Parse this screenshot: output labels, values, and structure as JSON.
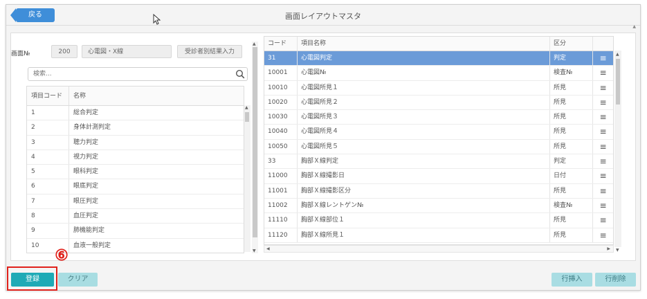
{
  "header": {
    "back_label": "戻る",
    "title": "画面レイアウトマスタ"
  },
  "form": {
    "screen_no_label": "画面№",
    "screen_no_value": "200",
    "screen_name_value": "心電図・X線",
    "result_input_button": "受診者別結果入力"
  },
  "search": {
    "placeholder": "検索..."
  },
  "left_table": {
    "columns": [
      "項目コード",
      "名称"
    ],
    "rows": [
      {
        "code": "1",
        "name": "総合判定"
      },
      {
        "code": "2",
        "name": "身体計測判定"
      },
      {
        "code": "3",
        "name": "聴力判定"
      },
      {
        "code": "4",
        "name": "視力判定"
      },
      {
        "code": "5",
        "name": "眼科判定"
      },
      {
        "code": "6",
        "name": "眼底判定"
      },
      {
        "code": "7",
        "name": "眼圧判定"
      },
      {
        "code": "8",
        "name": "血圧判定"
      },
      {
        "code": "9",
        "name": "肺機能判定"
      },
      {
        "code": "10",
        "name": "血液一般判定"
      }
    ]
  },
  "right_table": {
    "columns": [
      "コード",
      "項目名称",
      "区分"
    ],
    "rows": [
      {
        "code": "31",
        "name": "心電図判定",
        "kubun": "判定",
        "selected": true
      },
      {
        "code": "10001",
        "name": "心電図№",
        "kubun": "検査№"
      },
      {
        "code": "10010",
        "name": "心電図所見１",
        "kubun": "所見"
      },
      {
        "code": "10020",
        "name": "心電図所見２",
        "kubun": "所見"
      },
      {
        "code": "10030",
        "name": "心電図所見３",
        "kubun": "所見"
      },
      {
        "code": "10040",
        "name": "心電図所見４",
        "kubun": "所見"
      },
      {
        "code": "10050",
        "name": "心電図所見５",
        "kubun": "所見"
      },
      {
        "code": "33",
        "name": "胸部Ｘ線判定",
        "kubun": "判定"
      },
      {
        "code": "11000",
        "name": "胸部Ｘ線撮影日",
        "kubun": "日付"
      },
      {
        "code": "11001",
        "name": "胸部Ｘ線撮影区分",
        "kubun": "所見"
      },
      {
        "code": "11002",
        "name": "胸部Ｘ線レントゲン№",
        "kubun": "検査№"
      },
      {
        "code": "11110",
        "name": "胸部Ｘ線部位１",
        "kubun": "所見"
      },
      {
        "code": "11120",
        "name": "胸部Ｘ線所見１",
        "kubun": "所見"
      }
    ],
    "menu_glyph": "≡",
    "selected_color": "#6b9bd8"
  },
  "footer": {
    "register_label": "登録",
    "clear_label": "クリア",
    "insert_row_label": "行挿入",
    "delete_row_label": "行削除"
  },
  "annotation": {
    "step_badge": "⑥",
    "color": "#e0201a"
  },
  "colors": {
    "back": "#3f8ed9",
    "register": "#1faab6",
    "light_teal": "#a8dde2"
  }
}
